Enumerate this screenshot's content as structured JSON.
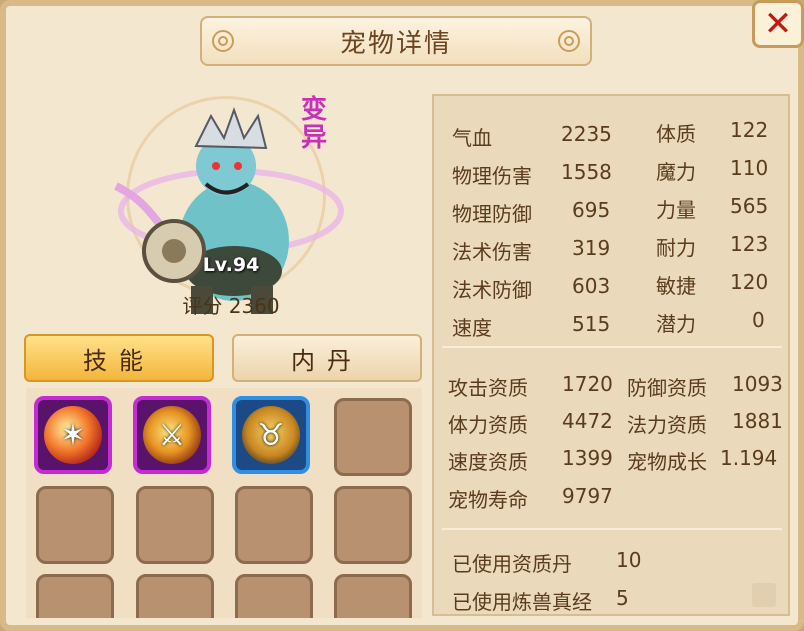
{
  "window": {
    "title": "宠物详情",
    "close_label": "✕"
  },
  "pet": {
    "mutation_badge": "变异",
    "level": "Lv.94",
    "score_label": "评分",
    "score_value": "2360"
  },
  "tabs": [
    {
      "label": "技能",
      "active": true
    },
    {
      "label": "内丹",
      "active": false
    }
  ],
  "skills": [
    {
      "icon": "fire-claw-skill-icon",
      "border": "purple"
    },
    {
      "icon": "blade-strike-skill-icon",
      "border": "purple"
    },
    {
      "icon": "bull-skill-icon",
      "border": "blue"
    }
  ],
  "attributes": [
    {
      "label": "气血",
      "value": "2235"
    },
    {
      "label": "物理伤害",
      "value": "1558"
    },
    {
      "label": "物理防御",
      "value": "695"
    },
    {
      "label": "法术伤害",
      "value": "319"
    },
    {
      "label": "法术防御",
      "value": "603"
    },
    {
      "label": "速度",
      "value": "515"
    }
  ],
  "base_stats": [
    {
      "label": "体质",
      "value": "122"
    },
    {
      "label": "魔力",
      "value": "110"
    },
    {
      "label": "力量",
      "value": "565"
    },
    {
      "label": "耐力",
      "value": "123"
    },
    {
      "label": "敏捷",
      "value": "120"
    },
    {
      "label": "潜力",
      "value": "0"
    }
  ],
  "aptitudes": [
    {
      "label": "攻击资质",
      "value": "1720"
    },
    {
      "label": "防御资质",
      "value": "1093"
    },
    {
      "label": "体力资质",
      "value": "4472"
    },
    {
      "label": "法力资质",
      "value": "1881"
    },
    {
      "label": "速度资质",
      "value": "1399"
    },
    {
      "label": "宠物成长",
      "value": "1.194"
    },
    {
      "label": "宠物寿命",
      "value": "9797"
    }
  ],
  "usage": [
    {
      "label": "已使用资质丹",
      "value": "10"
    },
    {
      "label": "已使用炼兽真经",
      "value": "5"
    }
  ],
  "colors": {
    "panel_bg": "#f4e7cf",
    "text_brown": "#5a3c1c",
    "mutation_magenta": "#c930b8",
    "close_red": "#c01a12",
    "tab_active_gold": "#f3b63b"
  }
}
